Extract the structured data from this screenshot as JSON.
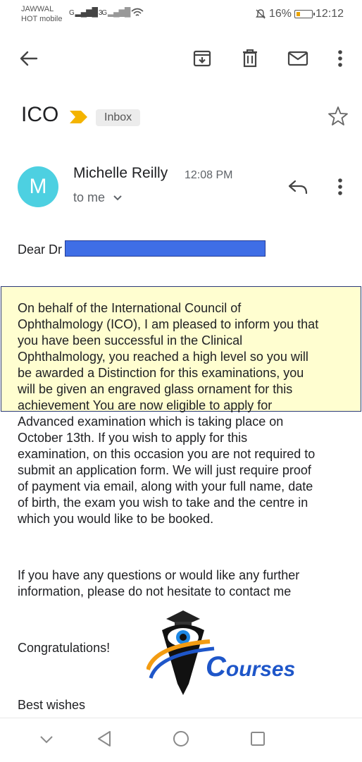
{
  "status_bar": {
    "carrier_line1": "JAWWAL",
    "carrier_line2": "HOT mobile",
    "signal_1": "G",
    "signal_2": "3G",
    "battery": "16%",
    "time": "12:12"
  },
  "toolbar": {
    "back_icon": "arrow-left-icon",
    "archive_icon": "archive-icon",
    "delete_icon": "trash-icon",
    "mark_unread_icon": "mail-icon",
    "more_icon": "more-vert-icon"
  },
  "email": {
    "subject": "ICO",
    "label": "Inbox",
    "sender_initial": "M",
    "sender_name": "Michelle Reilly",
    "time": "12:08 PM",
    "recipient": "to me",
    "greeting": "Dear Dr",
    "paragraph_highlight": [
      "On behalf of the International Council of",
      "Ophthalmology (ICO), I am pleased to inform you that",
      "you have been successful in the Clinical",
      "Ophthalmology, you reached a high level so you will",
      "be awarded a Distinction for this examinations, you",
      "will be given an engraved glass ornament for this",
      "achievement  You are now eligible to apply for"
    ],
    "paragraph_rest": [
      "Advanced examination which is taking place on",
      "October 13th.  If you wish to apply for this",
      "examination, on this occasion you are not required to",
      "submit an application form.  We will just require proof",
      "of payment via email, along with your full name, date",
      "of birth, the exam you wish to take and the centre in",
      "which you would like to be booked."
    ],
    "questions": [
      "If you have any questions or would like any further",
      "information, please do not hesitate to contact me"
    ],
    "congrats": "Congratulations!",
    "signoff": "Best wishes"
  },
  "watermark": {
    "logo_letter": "C",
    "logo_text": "ourses"
  },
  "colors": {
    "avatar": "#4dd0e1",
    "label_arrow": "#f4b400",
    "highlight": "#fffed0",
    "redaction": "#3f6ee6"
  }
}
